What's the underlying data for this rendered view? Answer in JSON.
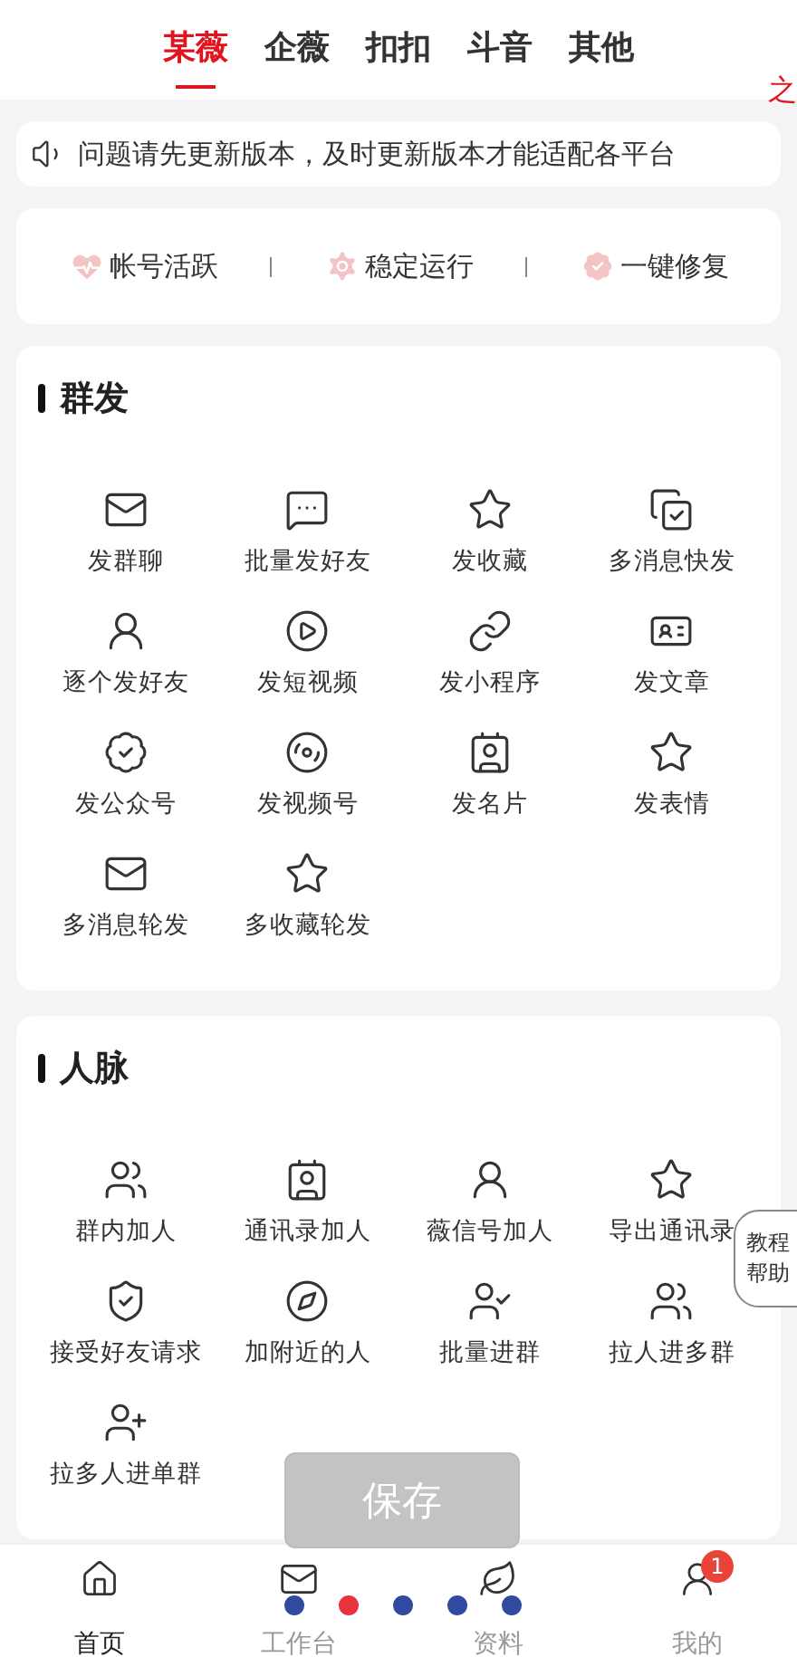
{
  "tabs": [
    {
      "label": "某薇",
      "selected": true
    },
    {
      "label": "企薇",
      "selected": false
    },
    {
      "label": "扣扣",
      "selected": false
    },
    {
      "label": "斗音",
      "selected": false
    },
    {
      "label": "其他",
      "selected": false
    }
  ],
  "corner_text": "之",
  "notice": {
    "text": "问题请先更新版本，及时更新版本才能适配各平台"
  },
  "status_items": [
    "帐号活跃",
    "稳定运行",
    "一键修复"
  ],
  "sections": [
    {
      "title": "群发",
      "items": [
        "发群聊",
        "批量发好友",
        "发收藏",
        "多消息快发",
        "逐个发好友",
        "发短视频",
        "发小程序",
        "发文章",
        "发公众号",
        "发视频号",
        "发名片",
        "发表情",
        "多消息轮发",
        "多收藏轮发"
      ]
    },
    {
      "title": "人脉",
      "items": [
        "群内加人",
        "通讯录加人",
        "薇信号加人",
        "导出通讯录",
        "接受好友请求",
        "加附近的人",
        "批量进群",
        "拉人进多群",
        "拉多人进单群"
      ]
    }
  ],
  "help_bubble": [
    "教程",
    "帮助"
  ],
  "save_button": "保存",
  "pager_dots": [
    {
      "selected": false
    },
    {
      "selected": true
    },
    {
      "selected": false
    },
    {
      "selected": false
    },
    {
      "selected": false
    }
  ],
  "bottom_nav": [
    {
      "label": "首页",
      "selected": true
    },
    {
      "label": "工作台",
      "selected": false
    },
    {
      "label": "资料",
      "selected": false
    },
    {
      "label": "我的",
      "selected": false,
      "badge": "1"
    }
  ]
}
